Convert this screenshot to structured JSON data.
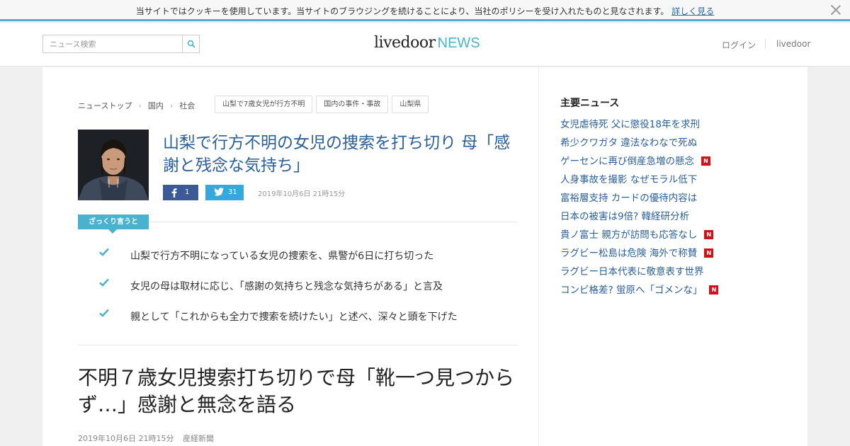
{
  "cookie_bar": {
    "message": "当サイトではクッキーを使用しています。当サイトのブラウジングを続けることにより、当社のポリシーを受け入れたものと見なされます。",
    "link_label": "詳しく見る"
  },
  "header": {
    "search_placeholder": "ニュース検索",
    "logo_main": "livedoor",
    "logo_news": "NEWS",
    "login_label": "ログイン",
    "livedoor_label": "livedoor"
  },
  "breadcrumb": {
    "items": [
      "ニューストップ",
      "国内",
      "社会"
    ],
    "tags": [
      "山梨で7歳女児が行方不明",
      "国内の事件・事故",
      "山梨県"
    ]
  },
  "article": {
    "title": "山梨で行方不明の女児の捜索を打ち切り 母「感謝と残念な気持ち」",
    "facebook_count": "1",
    "twitter_count": "31",
    "date": "2019年10月6日 21時15分",
    "summary_label": "ざっくり言うと",
    "points": [
      "山梨で行方不明になっている女児の捜索を、県警が6日に打ち切った",
      "女児の母は取材に応じ、「感謝の気持ちと残念な気持ちがある」と言及",
      "親として「これからも全力で捜索を続けたい」と述べ、深々と頭を下げた"
    ],
    "headline": "不明７歳女児捜索打ち切りで母「靴一つ見つからず…」感謝と無念を語る",
    "footer_date": "2019年10月6日 21時15分",
    "source": "産経新聞"
  },
  "sidebar": {
    "title": "主要ニュース",
    "items": [
      {
        "label": "女児虐待死 父に懲役18年を求刑",
        "badge": ""
      },
      {
        "label": "希少クワガタ 違法なわなで死ぬ",
        "badge": ""
      },
      {
        "label": "ゲーセンに再び倒産急増の懸念",
        "badge": "N"
      },
      {
        "label": "人身事故を撮影 なぜモラル低下",
        "badge": ""
      },
      {
        "label": "富裕層支持 カードの優待内容は",
        "badge": ""
      },
      {
        "label": "日本の被害は9倍? 韓経研分析",
        "badge": ""
      },
      {
        "label": "貴ノ富士 親方が訪問も応答なし",
        "badge": "N"
      },
      {
        "label": "ラグビー松島は危険 海外で称賛",
        "badge": "N"
      },
      {
        "label": "ラグビー日本代表に敬意表す世界",
        "badge": ""
      },
      {
        "label": "コンビ格差? 蛍原へ「ゴメンな」",
        "badge": "N"
      }
    ]
  },
  "colors": {
    "accent": "#49b3cf",
    "link": "#2a5f98",
    "facebook": "#3b5a96",
    "twitter": "#35a8dc",
    "badge": "#d0121b"
  }
}
